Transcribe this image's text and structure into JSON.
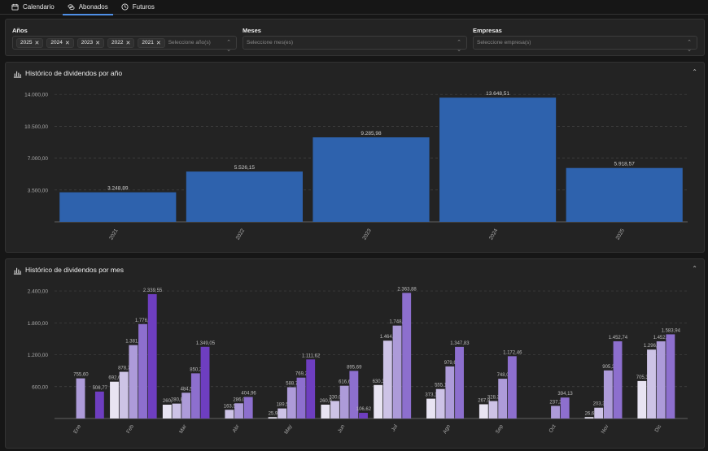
{
  "tabs": [
    {
      "label": "Calendario",
      "icon": "calendar-icon",
      "active": false
    },
    {
      "label": "Abonados",
      "icon": "coins-icon",
      "active": true
    },
    {
      "label": "Futuros",
      "icon": "clock-icon",
      "active": false
    }
  ],
  "filters": {
    "years": {
      "label": "Años",
      "chips": [
        "2025",
        "2024",
        "2023",
        "2022",
        "2021"
      ],
      "placeholder": "Seleccione año(s)"
    },
    "months": {
      "label": "Meses",
      "placeholder": "Seleccione mes(es)"
    },
    "companies": {
      "label": "Empresas",
      "placeholder": "Seleccione empresa(s)"
    }
  },
  "panels": {
    "yearly": {
      "title": "Histórico de dividendos por año",
      "icon": "bar-chart-icon"
    },
    "monthly": {
      "title": "Histórico de dividendos por mes",
      "icon": "bar-chart-icon"
    }
  },
  "colors": {
    "accent": "#4f8fe6",
    "yearly_bar": "#2e62ad",
    "monthly_series": [
      "#e8e4f2",
      "#cdc3e6",
      "#ad9bd9",
      "#8d6fce",
      "#6e3ec0"
    ]
  },
  "chart_data": [
    {
      "type": "bar",
      "categories": [
        "2021",
        "2022",
        "2023",
        "2024",
        "2025"
      ],
      "values": [
        3248.89,
        5526.15,
        9285.98,
        13648.51,
        5918.57
      ],
      "value_labels": [
        "3.248,89",
        "5.526,15",
        "9.285,98",
        "13.648,51",
        "5.918,57"
      ],
      "yticks": [
        3500,
        7000,
        10500,
        14000
      ],
      "ytick_labels": [
        "3.500,00",
        "7.000,00",
        "10.500,00",
        "14.000,00"
      ],
      "ylim": [
        0,
        15000
      ],
      "grid": true
    },
    {
      "type": "bar",
      "categories": [
        "Ene",
        "Feb",
        "Mar",
        "Abr",
        "May",
        "Jun",
        "Jul",
        "Ago",
        "Sep",
        "Oct",
        "Nov",
        "Dic"
      ],
      "series": [
        {
          "values": [
            0,
            692.6,
            260,
            0,
            25.9,
            260.9,
            630.3,
            373.1,
            267.9,
            0,
            26.6,
            705.3
          ],
          "labels": [
            "",
            "692,6",
            "260,",
            "",
            "25,9",
            "260,9",
            "630,3",
            "373,1",
            "267,9",
            "",
            "26,6",
            "705,3"
          ]
        },
        {
          "values": [
            0,
            878.7,
            280.8,
            163.5,
            189.5,
            330,
            1464.8,
            555.1,
            328.3,
            0,
            203.3,
            1296.6
          ],
          "labels": [
            "",
            "878,7",
            "280,8",
            "163,5",
            "189,5",
            "330,0",
            "1.464,8",
            "555,1",
            "328,3",
            "",
            "203,3",
            "1.296,6"
          ]
        },
        {
          "values": [
            755.6,
            1381.4,
            484.5,
            286,
            588.7,
            616.6,
            1748.6,
            979.6,
            748,
            237.2,
            905.3,
            1452.3
          ],
          "labels": [
            "755,60",
            "1.381,4",
            "484,5",
            "286,0",
            "588,7",
            "616,6",
            "1.748,6",
            "979,6",
            "748,0",
            "237,2",
            "905,3",
            "1.452,3"
          ]
        },
        {
          "values": [
            0,
            1776.6,
            850.3,
            404.96,
            769.2,
            895.69,
            2363.88,
            1347.83,
            1172.46,
            394.13,
            1452.74,
            1583.94
          ],
          "labels": [
            "",
            "1.776,6",
            "850,3",
            "404,96",
            "769,2",
            "895,69",
            "2.363,88",
            "1.347,83",
            "1.172,46",
            "394,13",
            "1.452,74",
            "1.583,94"
          ]
        },
        {
          "values": [
            506.77,
            2339.55,
            1349.05,
            0,
            1111.62,
            106.62,
            0,
            0,
            0,
            0,
            0,
            0
          ],
          "labels": [
            "506,77",
            "2.339,55",
            "1.349,05",
            "",
            "1.111,62",
            "106,62",
            "",
            "",
            "",
            "",
            "",
            ""
          ]
        }
      ],
      "yticks": [
        600,
        1200,
        1800,
        2400
      ],
      "ytick_labels": [
        "600,00",
        "1.200,00",
        "1.800,00",
        "2.400,00"
      ],
      "ylim": [
        0,
        2600
      ],
      "grid": true
    }
  ]
}
